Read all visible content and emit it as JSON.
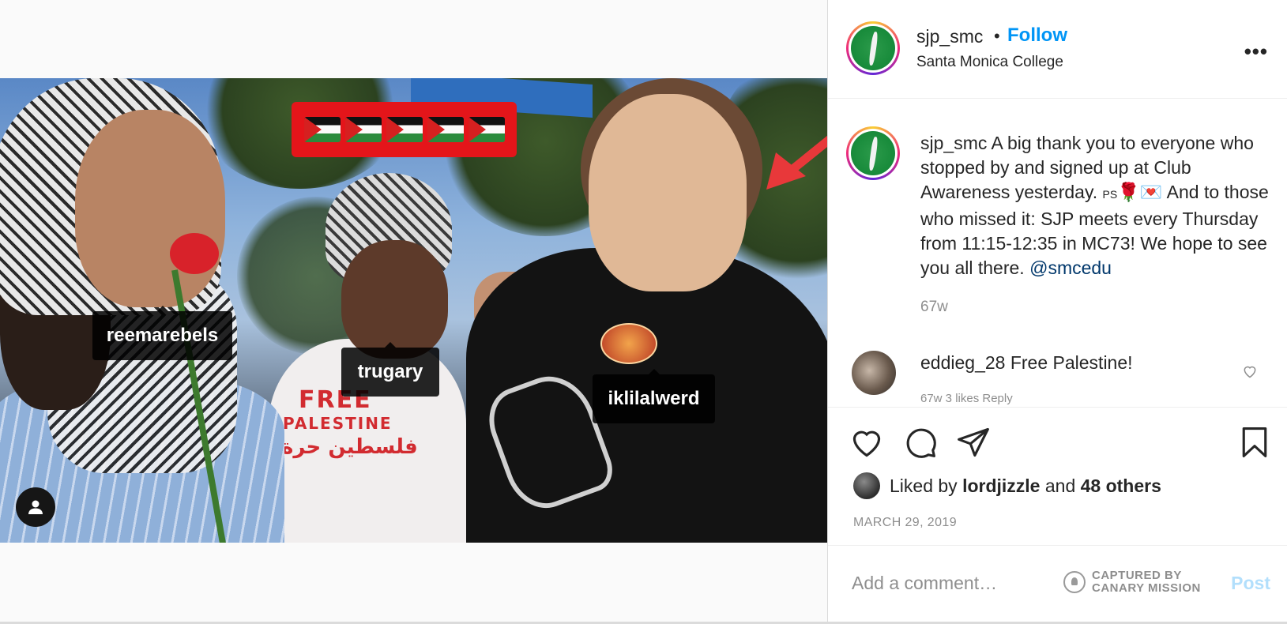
{
  "post": {
    "author": "sjp_smc",
    "follow_label": "Follow",
    "separator": "•",
    "location": "Santa Monica College",
    "more_label": "•••"
  },
  "photo": {
    "flags_count": 5,
    "tags": [
      {
        "name": "reemarebels"
      },
      {
        "name": "trugary"
      },
      {
        "name": "iklilalwerd"
      }
    ],
    "shirt_text_line1": "FREE",
    "shirt_text_line2": "PALESTINE",
    "shirt_text_line3": "فلسطين حرة"
  },
  "caption": {
    "username": "sjp_smc",
    "text_part1": " A big thank you to everyone who stopped by and signed up at Club Awareness yesterday. ",
    "ps": "PS",
    "emoji": "🌹💌",
    "text_part2": " And to those who missed it: SJP meets every Thursday from 11:15-12:35 in MC73! We hope to see you all there. ",
    "mention": "@smcedu",
    "age": "67w"
  },
  "comment": {
    "username": "eddieg_28",
    "text": " Free Palestine!",
    "meta": "67w   3 likes   Reply"
  },
  "likes": {
    "prefix": "Liked by ",
    "user": "lordjizzle",
    "middle": " and ",
    "others": "48 others"
  },
  "date": "MARCH 29, 2019",
  "add_comment": {
    "placeholder": "Add a comment…",
    "post_label": "Post"
  },
  "watermark": {
    "line1": "CAPTURED BY",
    "line2": "CANARY MISSION"
  },
  "colors": {
    "link_blue": "#0095f6",
    "annotation_red": "#e4151a",
    "arrow_red": "#e8383a"
  }
}
